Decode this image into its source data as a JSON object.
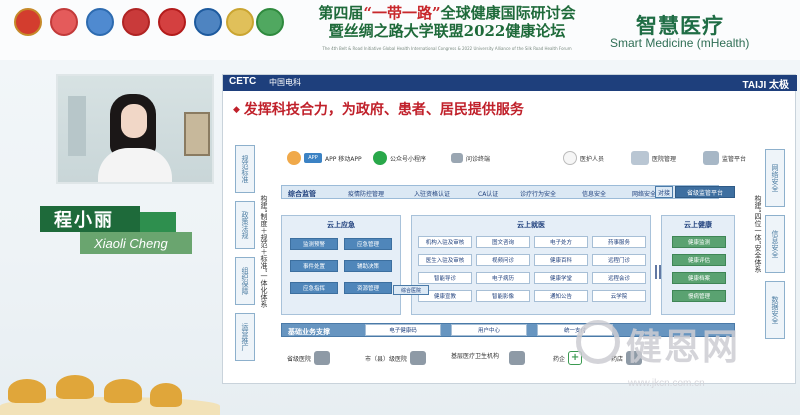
{
  "banner": {
    "title_line1_prefix": "第四届",
    "title_line1_quote": "“一带一路”",
    "title_line1_suffix": "全球健康国际研讨会",
    "title_line2": "暨丝绸之路大学联盟2022健康论坛",
    "subtitle": "The 4th Belt & Road Initiative Global Health International Congress & 2022 University Alliance of the Silk Road Health Forum",
    "brand_cn": "智慧医疗",
    "brand_en": "Smart Medicine (mHealth)",
    "logos": [
      "logo-1",
      "logo-2",
      "logo-3",
      "logo-4",
      "logo-5",
      "logo-6",
      "logo-7",
      "logo-8"
    ]
  },
  "speaker": {
    "name_cn": "程小丽",
    "name_en": "Xiaoli Cheng"
  },
  "slide": {
    "brand_left": "CETC",
    "brand_left_cn": "中国电科",
    "brand_right": "TAIJI 太极",
    "title": "发挥科技合力，为政府、患者、居民提供服务",
    "left_tags": [
      "规范标准",
      "政策法规",
      "组织保障",
      "运营推广"
    ],
    "left_caption": "构建“制度＋规范＋标准”一体化体系",
    "right_tags": [
      "网络安全",
      "信息安全",
      "数据安全"
    ],
    "right_caption": "构建“四位一体”安全体系",
    "users": [
      {
        "icon": "person-icon",
        "label": "APP 移动APP"
      },
      {
        "icon": "wechat-icon",
        "label": "公众号小程序"
      },
      {
        "icon": "device-icon",
        "label": "问诊终端"
      },
      {
        "icon": "doctor-icon",
        "label": "医护人员"
      },
      {
        "icon": "hospital-icon",
        "label": "医院管理"
      },
      {
        "icon": "regulator-icon",
        "label": "监管平台"
      }
    ],
    "supervision": {
      "label": "综合监管",
      "items": [
        "疫情防控管理",
        "入驻资格认证",
        "CA认证",
        "诊疗行为安全",
        "信息安全",
        "网络安全"
      ],
      "connector": "对接",
      "platform": "省级监管平台"
    },
    "emergency": {
      "title": "云上应急",
      "items": [
        "监测预警",
        "应急管理",
        "事件处置",
        "辅助决策",
        "应急指挥",
        "资源管理"
      ]
    },
    "clinic": {
      "title": "云上就医",
      "items": [
        "机构入驻及审核",
        "图文咨询",
        "电子处方",
        "药事服务",
        "医生入驻及审核",
        "视频问诊",
        "健康百科",
        "远程门诊",
        "智能导诊",
        "电子病历",
        "健康学堂",
        "远程会诊",
        "健康宣教",
        "智能影像",
        "通知公告",
        "云学院"
      ],
      "tag": "综合医院"
    },
    "health": {
      "title": "云上健康",
      "items": [
        "健康监测",
        "健康评估",
        "健康档案",
        "慢病管理"
      ]
    },
    "basic": {
      "label": "基础业务支撑",
      "items": [
        "电子健康码",
        "用户中心",
        "统一支付"
      ]
    },
    "facilities": [
      {
        "label": "省级医院"
      },
      {
        "label": "市（县）级医院"
      },
      {
        "label": "基层医疗卫生机构"
      },
      {
        "label": "药企"
      },
      {
        "label": "药店"
      }
    ]
  },
  "watermark": {
    "text": "健恩网",
    "url": "www.jkcn.com.cn"
  }
}
